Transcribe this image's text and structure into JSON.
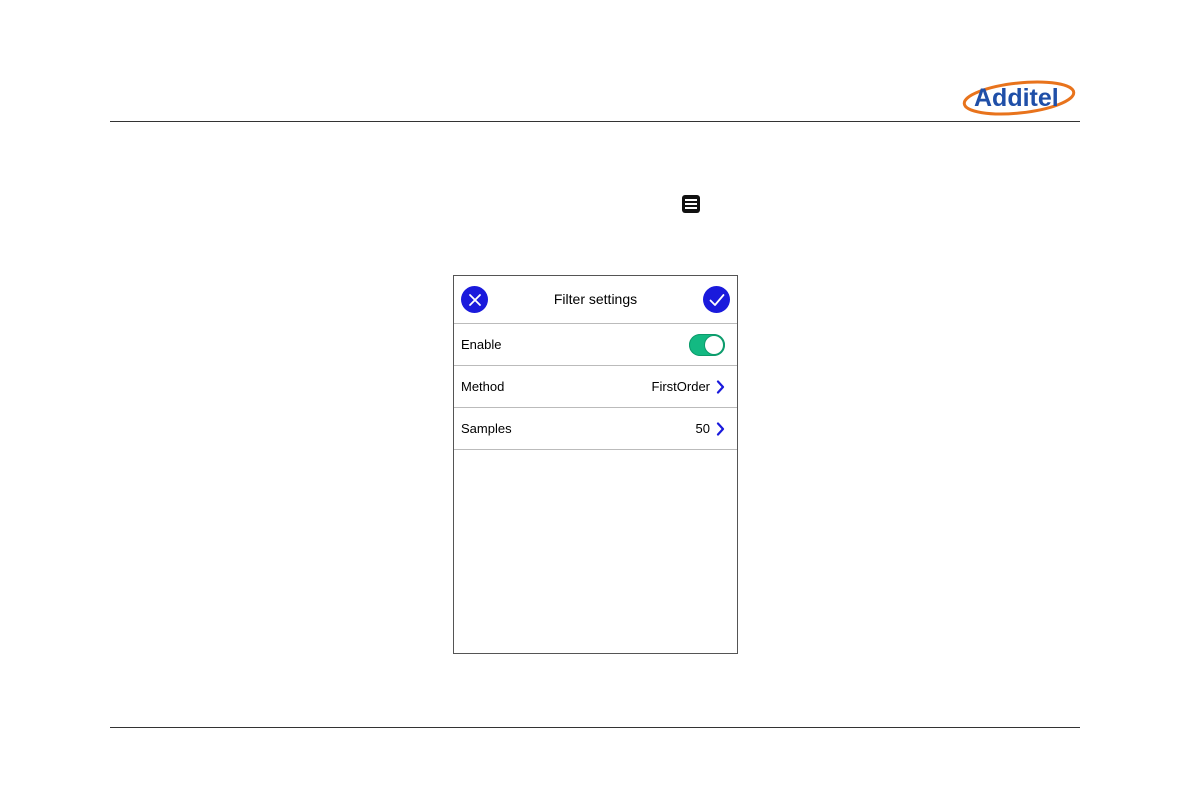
{
  "logo": {
    "text": "Additel"
  },
  "icons": {
    "menu": "menu-list-icon",
    "cancel": "close-icon",
    "confirm": "check-icon",
    "chevron": "chevron-right-icon"
  },
  "colors": {
    "accent": "#1a1adc",
    "toggle_on": "#13b982",
    "logo_blue": "#1f4fa8",
    "logo_orange": "#e8731c"
  },
  "dialog": {
    "title": "Filter settings",
    "rows": [
      {
        "label": "Enable",
        "type": "toggle",
        "state": "on"
      },
      {
        "label": "Method",
        "value": "FirstOrder"
      },
      {
        "label": "Samples",
        "value": "50"
      }
    ]
  }
}
